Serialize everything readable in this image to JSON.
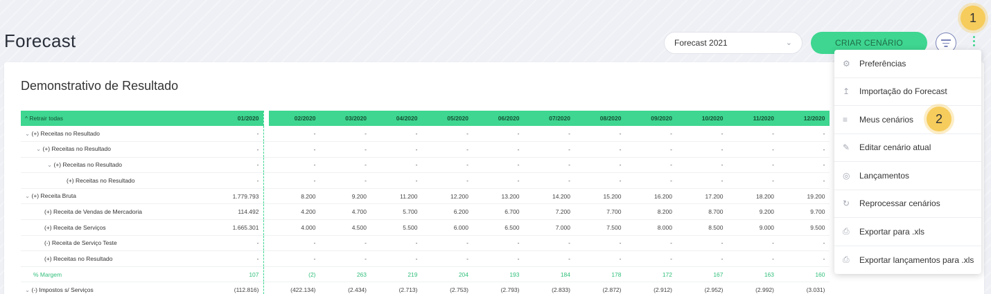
{
  "page": {
    "title": "Forecast"
  },
  "header": {
    "scenario_select": {
      "value": "Forecast 2021",
      "icon": "chevron-down-icon"
    },
    "create_button": "CRIAR CENÁRIO",
    "filter_icon": "filter-icon",
    "more_icon": "kebab-menu-icon"
  },
  "callouts": [
    "1",
    "2"
  ],
  "card": {
    "title": "Demonstrativo de Resultado",
    "table": {
      "collapse_all": "Retrair todas",
      "columns": [
        "01/2020",
        "02/2020",
        "03/2020",
        "04/2020",
        "05/2020",
        "06/2020",
        "07/2020",
        "08/2020",
        "09/2020",
        "10/2020",
        "11/2020",
        "12/2020"
      ],
      "rows": [
        {
          "label": "(+) Receitas no Resultado",
          "level": 0,
          "caret": true,
          "values": [
            "-",
            "-",
            "-",
            "-",
            "-",
            "-",
            "-",
            "-",
            "-",
            "-",
            "-",
            "-"
          ]
        },
        {
          "label": "(+) Receitas no Resultado",
          "level": 1,
          "caret": true,
          "values": [
            "-",
            "-",
            "-",
            "-",
            "-",
            "-",
            "-",
            "-",
            "-",
            "-",
            "-",
            "-"
          ]
        },
        {
          "label": "(+) Receitas no Resultado",
          "level": 2,
          "caret": true,
          "values": [
            "-",
            "-",
            "-",
            "-",
            "-",
            "-",
            "-",
            "-",
            "-",
            "-",
            "-",
            "-"
          ]
        },
        {
          "label": "(+) Receitas no Resultado",
          "level": 3,
          "caret": false,
          "values": [
            "-",
            "-",
            "-",
            "-",
            "-",
            "-",
            "-",
            "-",
            "-",
            "-",
            "-",
            "-"
          ]
        },
        {
          "label": "(+) Receita Bruta",
          "level": 0,
          "caret": true,
          "values": [
            "1.779.793",
            "8.200",
            "9.200",
            "11.200",
            "12.200",
            "13.200",
            "14.200",
            "15.200",
            "16.200",
            "17.200",
            "18.200",
            "19.200"
          ]
        },
        {
          "label": "(+) Receita de Vendas de Mercadoria",
          "level": 1,
          "caret": false,
          "values": [
            "114.492",
            "4.200",
            "4.700",
            "5.700",
            "6.200",
            "6.700",
            "7.200",
            "7.700",
            "8.200",
            "8.700",
            "9.200",
            "9.700"
          ]
        },
        {
          "label": "(+) Receita de Serviços",
          "level": 1,
          "caret": false,
          "values": [
            "1.665.301",
            "4.000",
            "4.500",
            "5.500",
            "6.000",
            "6.500",
            "7.000",
            "7.500",
            "8.000",
            "8.500",
            "9.000",
            "9.500"
          ]
        },
        {
          "label": "(-) Receita de Serviço Teste",
          "level": 1,
          "caret": false,
          "values": [
            "-",
            "-",
            "-",
            "-",
            "-",
            "-",
            "-",
            "-",
            "-",
            "-",
            "-",
            "-"
          ]
        },
        {
          "label": "(+) Receitas no Resultado",
          "level": 1,
          "caret": false,
          "values": [
            "-",
            "-",
            "-",
            "-",
            "-",
            "-",
            "-",
            "-",
            "-",
            "-",
            "-",
            "-"
          ]
        },
        {
          "label": "% Margem",
          "level": 0,
          "caret": false,
          "margin": true,
          "values": [
            "107",
            "(2)",
            "263",
            "219",
            "204",
            "193",
            "184",
            "178",
            "172",
            "167",
            "163",
            "160"
          ]
        },
        {
          "label": "(-) Impostos s/ Serviços",
          "level": 0,
          "caret": true,
          "values": [
            "(112.816)",
            "(422.134)",
            "(2.434)",
            "(2.713)",
            "(2.753)",
            "(2.793)",
            "(2.833)",
            "(2.872)",
            "(2.912)",
            "(2.952)",
            "(2.992)",
            "(3.031)"
          ]
        }
      ]
    }
  },
  "menu": {
    "items": [
      {
        "label": "Preferências",
        "icon": "gear-icon"
      },
      {
        "label": "Importação do Forecast",
        "icon": "upload-icon"
      },
      {
        "label": "Meus cenários",
        "icon": "list-icon"
      },
      {
        "label": "Editar cenário atual",
        "icon": "pencil-icon"
      },
      {
        "label": "Lançamentos",
        "icon": "circle-icon"
      },
      {
        "label": "Reprocessar cenários",
        "icon": "refresh-icon"
      },
      {
        "label": "Exportar para .xls",
        "icon": "file-xls-icon"
      },
      {
        "label": "Exportar lançamentos para .xls",
        "icon": "file-xls-icon"
      }
    ]
  }
}
